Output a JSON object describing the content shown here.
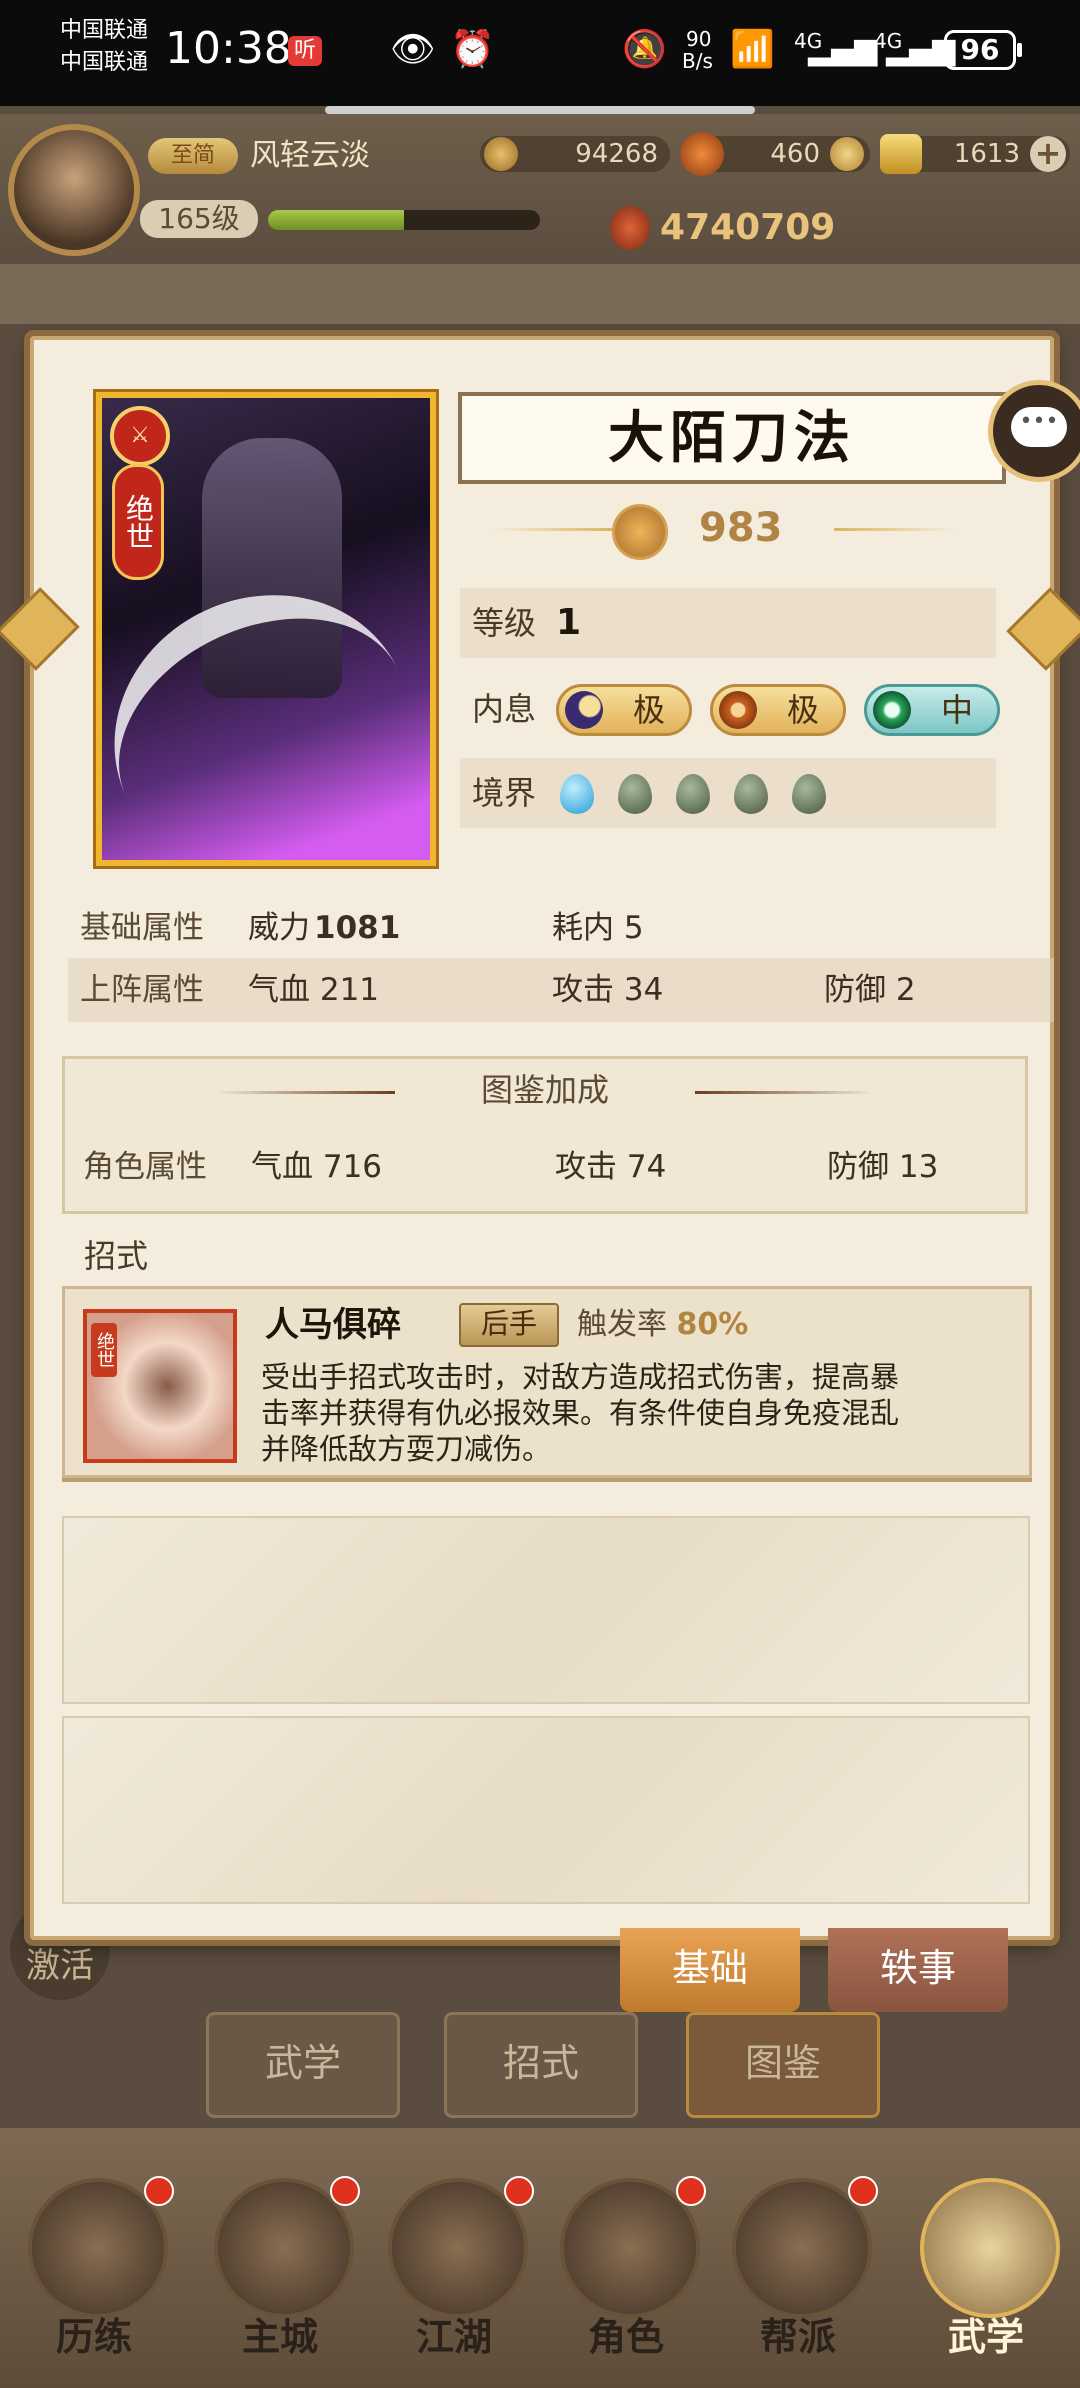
{
  "status_bar": {
    "carrier1": "中国联通",
    "carrier2": "中国联通",
    "time": "10:38",
    "badge": "听",
    "net_speed_value": "90",
    "net_speed_unit": "B/s",
    "signal1": "4G",
    "signal2": "4G",
    "battery": "96"
  },
  "header": {
    "vip_label": "至简",
    "player_name": "风轻云淡",
    "coins": "94268",
    "gems": "460",
    "gold": "1613",
    "level": "165级",
    "power": "4740709",
    "xp_fraction": 0.5
  },
  "detail": {
    "card_rank": "绝世",
    "skill_title": "大陌刀法",
    "rating": "983",
    "level_label": "等级",
    "level_value": "1",
    "inner_label": "内息",
    "inner_pills": [
      "极",
      "极",
      "中"
    ],
    "realm_label": "境界",
    "realm_filled": 1,
    "realm_total": 5
  },
  "stats": {
    "base_label": "基础属性",
    "base_power": "威力",
    "base_power_value": "1081",
    "base_cost": "耗内 5",
    "deploy_label": "上阵属性",
    "deploy_hp": "气血 211",
    "deploy_atk": "攻击 34",
    "deploy_def": "防御 2"
  },
  "bonus": {
    "title": "图鉴加成",
    "row_label": "角色属性",
    "hp": "气血 716",
    "atk": "攻击 74",
    "def": "防御 13"
  },
  "moves": {
    "header": "招式",
    "icon_tag": "绝世",
    "move_name": "人马俱碎",
    "move_tag": "后手",
    "trigger_label": "触发率",
    "trigger_value": "80%",
    "description": "受出手招式攻击时，对敌方造成招式伤害，提高暴击率并获得有仇必报效果。有条件使自身免疫混乱并降低敌方耍刀减伤。"
  },
  "bottom": {
    "activate": "激活",
    "tab_basic": "基础",
    "tab_story": "轶事",
    "sub_tabs": [
      "武学",
      "招式",
      "图鉴"
    ]
  },
  "nav": [
    "历练",
    "主城",
    "江湖",
    "角色",
    "帮派",
    "武学"
  ]
}
